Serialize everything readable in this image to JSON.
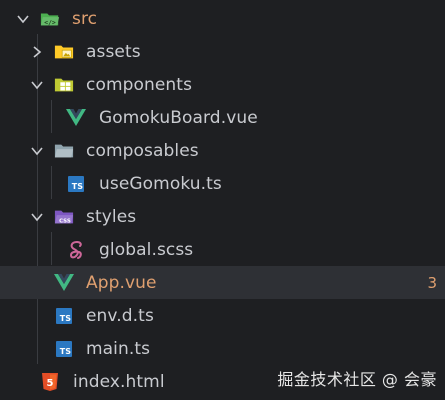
{
  "tree": {
    "src": {
      "label": "src",
      "icon": "folder-src-open-icon"
    },
    "assets": {
      "label": "assets",
      "icon": "folder-assets-icon"
    },
    "components": {
      "label": "components",
      "icon": "folder-components-open-icon"
    },
    "gomoku_board": {
      "label": "GomokuBoard.vue",
      "icon": "vue-file-icon"
    },
    "composables": {
      "label": "composables",
      "icon": "folder-composables-open-icon"
    },
    "use_gomoku": {
      "label": "useGomoku.ts",
      "icon": "typescript-file-icon"
    },
    "styles": {
      "label": "styles",
      "icon": "folder-css-open-icon"
    },
    "global_scss": {
      "label": "global.scss",
      "icon": "sass-file-icon"
    },
    "app_vue": {
      "label": "App.vue",
      "icon": "vue-file-icon",
      "problems": "3"
    },
    "env_d_ts": {
      "label": "env.d.ts",
      "icon": "typescript-file-icon"
    },
    "main_ts": {
      "label": "main.ts",
      "icon": "typescript-file-icon"
    },
    "index_html": {
      "label": "index.html",
      "icon": "html-file-icon"
    }
  },
  "ts_badge": "TS",
  "watermark": "掘金技术社区 @ 会豪",
  "colors": {
    "background": "#1e1f22",
    "selected_row": "#2e3035",
    "text": "#c9cbd0",
    "modified_text": "#e0a070",
    "vue_green": "#41b883",
    "vue_dark": "#34495e",
    "ts_blue": "#2b78c2",
    "sass_pink": "#cd6799",
    "html_orange": "#e44d26"
  }
}
